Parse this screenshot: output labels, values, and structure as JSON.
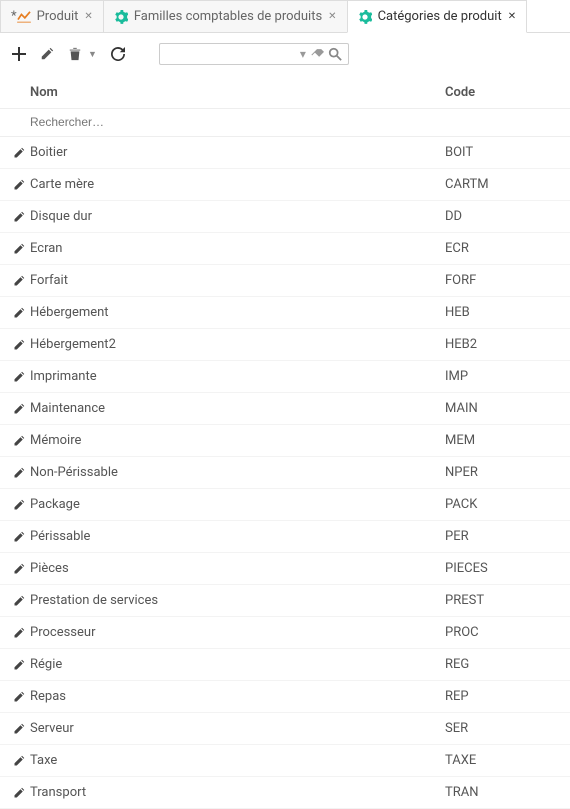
{
  "tabs": [
    {
      "label": "Produit",
      "prefix": "* ",
      "icon": "chart",
      "active": false
    },
    {
      "label": "Familles comptables de produits",
      "prefix": "",
      "icon": "gear",
      "active": false
    },
    {
      "label": "Catégories de produit",
      "prefix": "",
      "icon": "gear",
      "active": true
    }
  ],
  "toolbar": {
    "add": "+",
    "search_placeholder": ""
  },
  "columns": {
    "nom": "Nom",
    "code": "Code"
  },
  "row_search_placeholder": "Rechercher…",
  "rows": [
    {
      "nom": "Boitier",
      "code": "BOIT"
    },
    {
      "nom": "Carte mère",
      "code": "CARTM"
    },
    {
      "nom": "Disque dur",
      "code": "DD"
    },
    {
      "nom": "Ecran",
      "code": "ECR"
    },
    {
      "nom": "Forfait",
      "code": "FORF"
    },
    {
      "nom": "Hébergement",
      "code": "HEB"
    },
    {
      "nom": "Hébergement2",
      "code": "HEB2"
    },
    {
      "nom": "Imprimante",
      "code": "IMP"
    },
    {
      "nom": "Maintenance",
      "code": "MAIN"
    },
    {
      "nom": "Mémoire",
      "code": "MEM"
    },
    {
      "nom": "Non-Périssable",
      "code": "NPER"
    },
    {
      "nom": "Package",
      "code": "PACK"
    },
    {
      "nom": "Périssable",
      "code": "PER"
    },
    {
      "nom": "Pièces",
      "code": "PIECES"
    },
    {
      "nom": "Prestation de services",
      "code": "PREST"
    },
    {
      "nom": "Processeur",
      "code": "PROC"
    },
    {
      "nom": "Régie",
      "code": "REG"
    },
    {
      "nom": "Repas",
      "code": "REP"
    },
    {
      "nom": "Serveur",
      "code": "SER"
    },
    {
      "nom": "Taxe",
      "code": "TAXE"
    },
    {
      "nom": "Transport",
      "code": "TRAN"
    }
  ],
  "colors": {
    "teal": "#1abc9c",
    "orange": "#e67e22"
  }
}
